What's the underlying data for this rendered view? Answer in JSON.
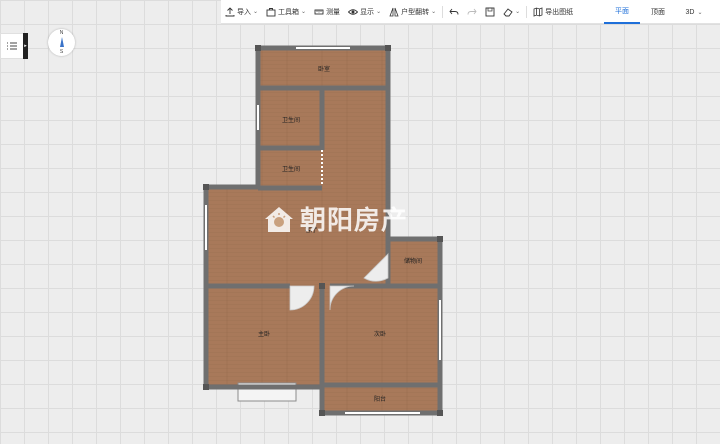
{
  "toolbar": {
    "import_label": "导入",
    "tools_label": "工具箱",
    "measure_label": "测量",
    "display_label": "显示",
    "flip_label": "户型翻转",
    "export_label": "导出图纸"
  },
  "views": {
    "plan_label": "平面",
    "top_label": "顶面",
    "three_d_label": "3D"
  },
  "compass": {
    "n": "N",
    "s": "S"
  },
  "watermark": {
    "text": "朝阳房产"
  },
  "rooms": {
    "room_top": "卧室",
    "bath_1": "卫生间",
    "bath_2": "卫生间",
    "living": "客厅",
    "storage": "储物间",
    "master": "主卧",
    "second": "次卧",
    "balcony": "阳台"
  },
  "colors": {
    "accent": "#1e6fd9",
    "floor": "#a8795a",
    "wall": "#6f6f6f"
  }
}
